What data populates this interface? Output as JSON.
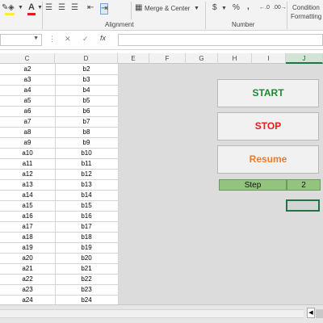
{
  "ribbon": {
    "merge_center_label": "Merge & Center",
    "alignment_group_label": "Alignment",
    "number_group_label": "Number",
    "currency_symbol": "$",
    "percent_symbol": "%",
    "comma_symbol": ",",
    "conditional_label_line1": "Condition",
    "conditional_label_line2": "Formatting",
    "font_color_label": "A",
    "font_color": "#e7191f",
    "fill_color": "#f7ef2d"
  },
  "formula_bar": {
    "cancel_symbol": "✕",
    "enter_symbol": "✓",
    "fx_label": "fx"
  },
  "columns": [
    {
      "label": "C"
    },
    {
      "label": "D"
    },
    {
      "label": "E"
    },
    {
      "label": "F"
    },
    {
      "label": "G"
    },
    {
      "label": "H"
    },
    {
      "label": "I"
    },
    {
      "label": "J"
    }
  ],
  "rows": [
    {
      "c": "a2",
      "d": "b2"
    },
    {
      "c": "a3",
      "d": "b3"
    },
    {
      "c": "a4",
      "d": "b4"
    },
    {
      "c": "a5",
      "d": "b5"
    },
    {
      "c": "a6",
      "d": "b6"
    },
    {
      "c": "a7",
      "d": "b7"
    },
    {
      "c": "a8",
      "d": "b8"
    },
    {
      "c": "a9",
      "d": "b9"
    },
    {
      "c": "a10",
      "d": "b10"
    },
    {
      "c": "a11",
      "d": "b11"
    },
    {
      "c": "a12",
      "d": "b12"
    },
    {
      "c": "a13",
      "d": "b13"
    },
    {
      "c": "a14",
      "d": "b14"
    },
    {
      "c": "a15",
      "d": "b15"
    },
    {
      "c": "a16",
      "d": "b16"
    },
    {
      "c": "a17",
      "d": "b17"
    },
    {
      "c": "a18",
      "d": "b18"
    },
    {
      "c": "a19",
      "d": "b19"
    },
    {
      "c": "a20",
      "d": "b20"
    },
    {
      "c": "a21",
      "d": "b21"
    },
    {
      "c": "a22",
      "d": "b22"
    },
    {
      "c": "a23",
      "d": "b23"
    },
    {
      "c": "a24",
      "d": "b24"
    }
  ],
  "buttons": {
    "start_label": "START",
    "stop_label": "STOP",
    "resume_label": "Resume"
  },
  "step": {
    "label": "Step",
    "value": "2"
  },
  "colors": {
    "excel_green": "#217346",
    "step_fill": "#93c47d",
    "start_text": "#1e8a2e",
    "stop_text": "#ea1b1b",
    "resume_text": "#f07b22"
  }
}
